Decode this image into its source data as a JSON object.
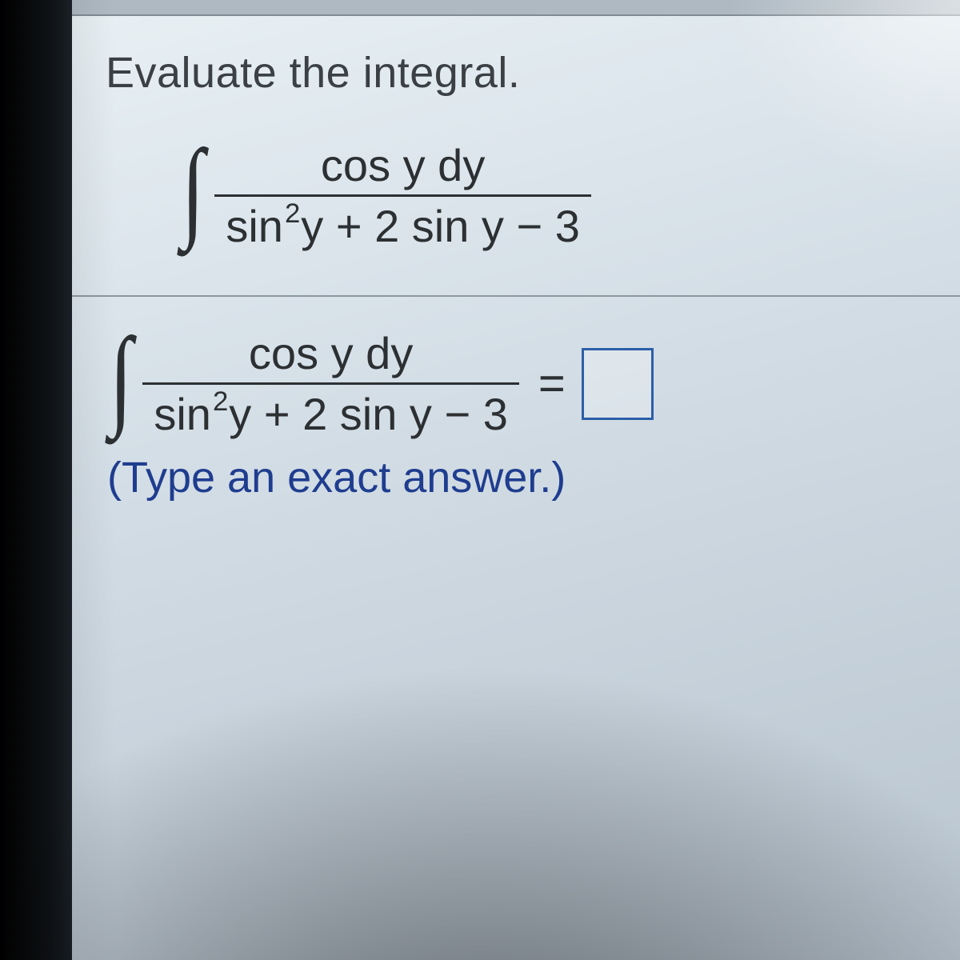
{
  "problem": {
    "prompt": "Evaluate the integral.",
    "integral": {
      "numerator": "cos y dy",
      "denom_pre": "sin",
      "denom_exp": "2",
      "denom_post": "y + 2 sin y − 3"
    }
  },
  "answer": {
    "integral": {
      "numerator": "cos y dy",
      "denom_pre": "sin",
      "denom_exp": "2",
      "denom_post": "y + 2 sin y − 3"
    },
    "equals": "=",
    "hint": "(Type an exact answer.)"
  },
  "integral_symbol": "∫"
}
